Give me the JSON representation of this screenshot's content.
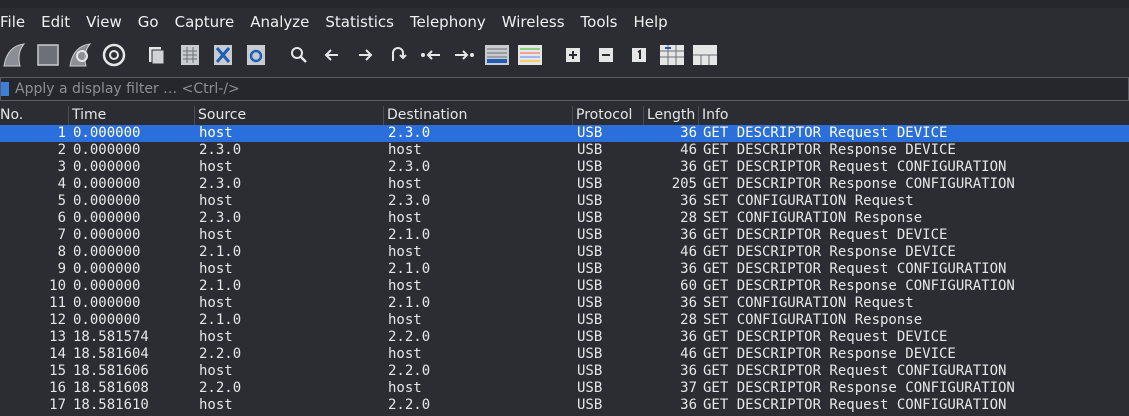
{
  "menu": [
    "File",
    "Edit",
    "View",
    "Go",
    "Capture",
    "Analyze",
    "Statistics",
    "Telephony",
    "Wireless",
    "Tools",
    "Help"
  ],
  "toolbar": {
    "icons": [
      "shark-fin-start-icon",
      "stop-capture-icon",
      "restart-capture-icon",
      "capture-options-icon",
      "open-file-icon",
      "save-file-icon",
      "close-file-icon",
      "reload-file-icon",
      "find-packet-icon",
      "go-back-icon",
      "go-forward-icon",
      "go-to-packet-icon",
      "go-first-packet-icon",
      "go-last-packet-icon",
      "autoscroll-icon",
      "colorize-icon",
      "zoom-in-icon",
      "zoom-out-icon",
      "normal-size-icon",
      "resize-columns-icon",
      "pane-layout-icon"
    ]
  },
  "filter": {
    "placeholder": "Apply a display filter … <Ctrl-/>"
  },
  "columns": {
    "no": "No.",
    "time": "Time",
    "source": "Source",
    "destination": "Destination",
    "protocol": "Protocol",
    "length": "Length",
    "info": "Info"
  },
  "colors": {
    "selected": "#2a6fdb",
    "background": "#2b2d33"
  },
  "packets": [
    {
      "no": "1",
      "time": "0.000000",
      "source": "host",
      "destination": "2.3.0",
      "protocol": "USB",
      "length": "36",
      "info": "GET DESCRIPTOR Request DEVICE"
    },
    {
      "no": "2",
      "time": "0.000000",
      "source": "2.3.0",
      "destination": "host",
      "protocol": "USB",
      "length": "46",
      "info": "GET DESCRIPTOR Response DEVICE"
    },
    {
      "no": "3",
      "time": "0.000000",
      "source": "host",
      "destination": "2.3.0",
      "protocol": "USB",
      "length": "36",
      "info": "GET DESCRIPTOR Request CONFIGURATION"
    },
    {
      "no": "4",
      "time": "0.000000",
      "source": "2.3.0",
      "destination": "host",
      "protocol": "USB",
      "length": "205",
      "info": "GET DESCRIPTOR Response CONFIGURATION"
    },
    {
      "no": "5",
      "time": "0.000000",
      "source": "host",
      "destination": "2.3.0",
      "protocol": "USB",
      "length": "36",
      "info": "SET CONFIGURATION Request"
    },
    {
      "no": "6",
      "time": "0.000000",
      "source": "2.3.0",
      "destination": "host",
      "protocol": "USB",
      "length": "28",
      "info": "SET CONFIGURATION Response"
    },
    {
      "no": "7",
      "time": "0.000000",
      "source": "host",
      "destination": "2.1.0",
      "protocol": "USB",
      "length": "36",
      "info": "GET DESCRIPTOR Request DEVICE"
    },
    {
      "no": "8",
      "time": "0.000000",
      "source": "2.1.0",
      "destination": "host",
      "protocol": "USB",
      "length": "46",
      "info": "GET DESCRIPTOR Response DEVICE"
    },
    {
      "no": "9",
      "time": "0.000000",
      "source": "host",
      "destination": "2.1.0",
      "protocol": "USB",
      "length": "36",
      "info": "GET DESCRIPTOR Request CONFIGURATION"
    },
    {
      "no": "10",
      "time": "0.000000",
      "source": "2.1.0",
      "destination": "host",
      "protocol": "USB",
      "length": "60",
      "info": "GET DESCRIPTOR Response CONFIGURATION"
    },
    {
      "no": "11",
      "time": "0.000000",
      "source": "host",
      "destination": "2.1.0",
      "protocol": "USB",
      "length": "36",
      "info": "SET CONFIGURATION Request"
    },
    {
      "no": "12",
      "time": "0.000000",
      "source": "2.1.0",
      "destination": "host",
      "protocol": "USB",
      "length": "28",
      "info": "SET CONFIGURATION Response"
    },
    {
      "no": "13",
      "time": "18.581574",
      "source": "host",
      "destination": "2.2.0",
      "protocol": "USB",
      "length": "36",
      "info": "GET DESCRIPTOR Request DEVICE"
    },
    {
      "no": "14",
      "time": "18.581604",
      "source": "2.2.0",
      "destination": "host",
      "protocol": "USB",
      "length": "46",
      "info": "GET DESCRIPTOR Response DEVICE"
    },
    {
      "no": "15",
      "time": "18.581606",
      "source": "host",
      "destination": "2.2.0",
      "protocol": "USB",
      "length": "36",
      "info": "GET DESCRIPTOR Request CONFIGURATION"
    },
    {
      "no": "16",
      "time": "18.581608",
      "source": "2.2.0",
      "destination": "host",
      "protocol": "USB",
      "length": "37",
      "info": "GET DESCRIPTOR Response CONFIGURATION"
    },
    {
      "no": "17",
      "time": "18.581610",
      "source": "host",
      "destination": "2.2.0",
      "protocol": "USB",
      "length": "36",
      "info": "GET DESCRIPTOR Request CONFIGURATION"
    }
  ],
  "selected_packet": "1"
}
